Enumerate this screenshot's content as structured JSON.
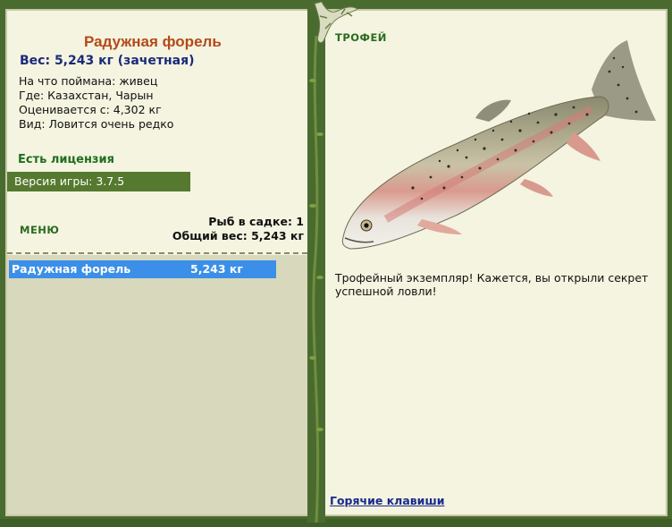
{
  "fish": {
    "name": "Радужная форель",
    "weight_line": "Вес: 5,243 кг (зачетная)",
    "caught_on": "На что поймана: живец",
    "where": "Где: Казахстан, Чарын",
    "valued_from": "Оценивается с: 4,302 кг",
    "kind": "Вид: Ловится очень редко"
  },
  "license": "Есть лицензия",
  "version": "Версия игры: 3.7.5",
  "menu_label": "МЕНЮ",
  "stats": {
    "fish_in_keepnet": "Рыб в садке: 1",
    "total_weight": "Общий вес: 5,243 кг"
  },
  "catch_list": [
    {
      "name": "Радужная форель",
      "weight": "5,243 кг"
    }
  ],
  "trophy_label": "ТРОФЕЙ",
  "description": "Трофейный экземпляр! Кажется, вы открыли секрет успешной ловли!",
  "hotkeys_link": "Горячие клавиши",
  "colors": {
    "frame": "#4a6b2f",
    "panel": "#f4f4e0",
    "selection": "#3b8fe8",
    "title": "#b34a1a"
  }
}
